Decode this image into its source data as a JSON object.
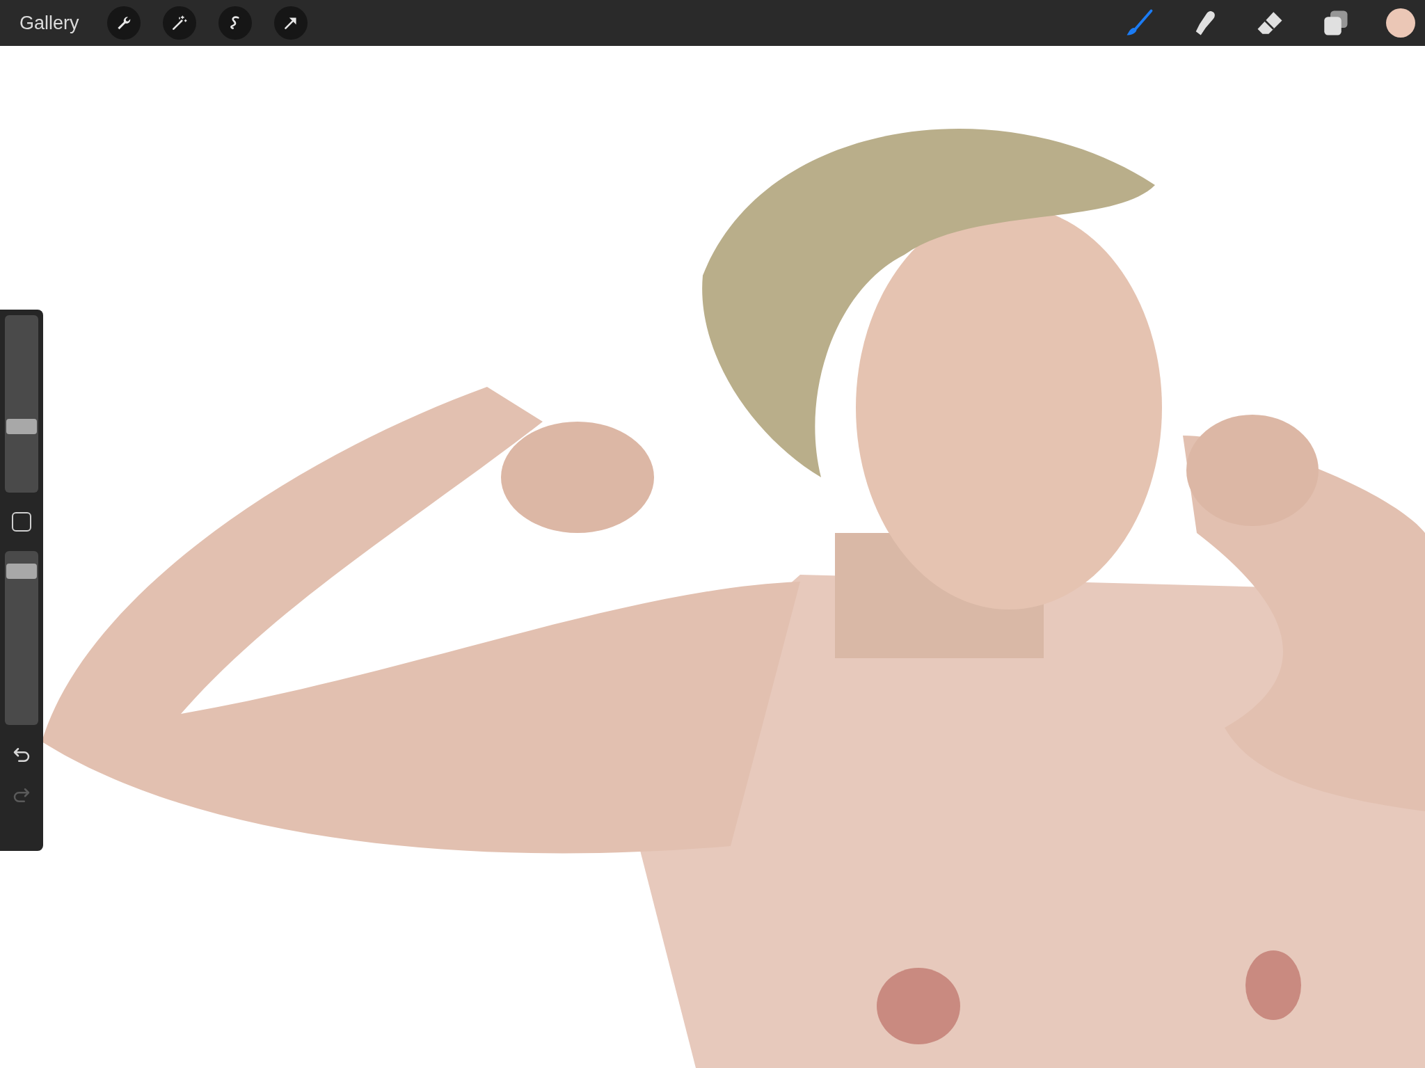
{
  "toolbar": {
    "gallery": "Gallery",
    "left_tools": [
      {
        "kind": "wrench"
      },
      {
        "kind": "wand"
      },
      {
        "kind": "selection"
      },
      {
        "kind": "transform"
      }
    ],
    "right_tools": [
      {
        "kind": "brush",
        "selected": true
      },
      {
        "kind": "smudge",
        "selected": false
      },
      {
        "kind": "eraser",
        "selected": false
      },
      {
        "kind": "layers",
        "selected": false
      }
    ]
  },
  "sidebar": {
    "sliders": [
      {
        "kind": "size",
        "level": 0.36
      },
      {
        "kind": "opacity",
        "level": 0.92
      }
    ],
    "undo": {
      "disabled": false
    },
    "redo": {
      "disabled": true
    }
  }
}
